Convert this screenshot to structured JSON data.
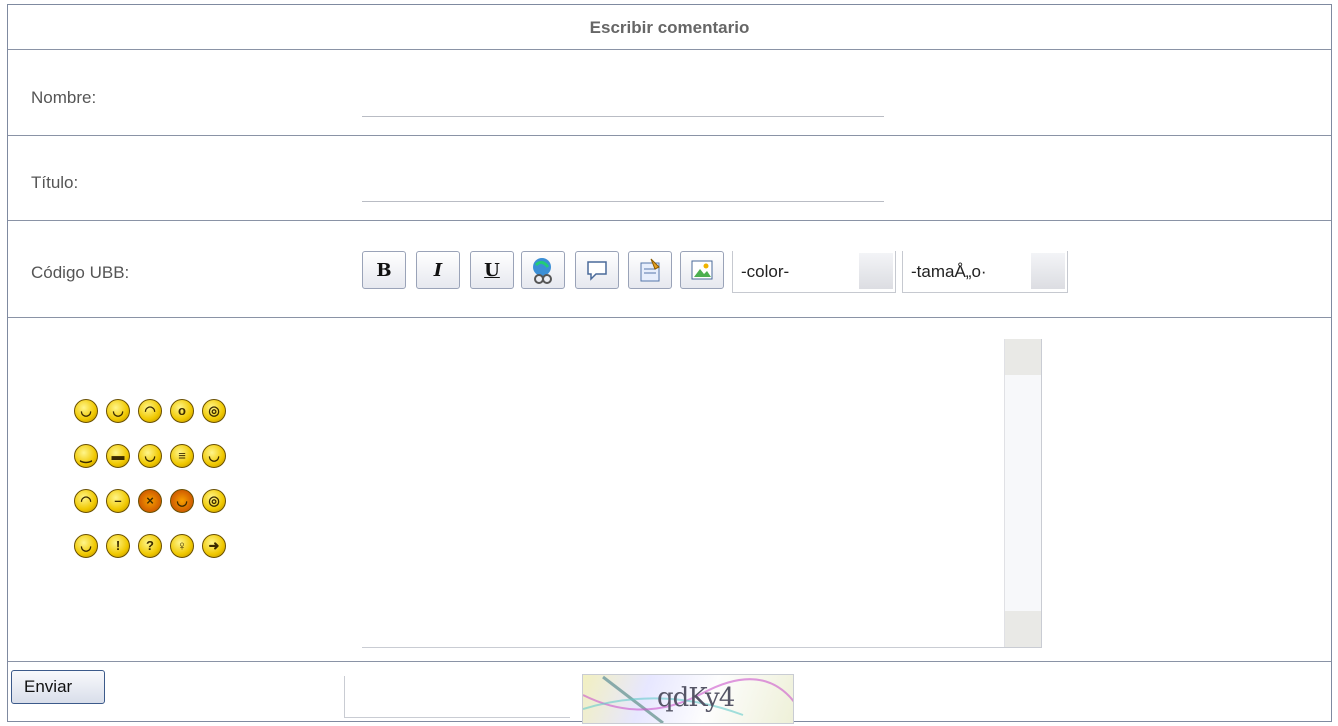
{
  "form": {
    "title": "Escribir comentario",
    "name_label": "Nombre:",
    "title_label": "Título:",
    "ubb_label": "Código UBB:",
    "submit_label": "Enviar",
    "color_select": "-color-",
    "size_select": "-tamaÅ„o·",
    "captcha_text": "qdKy4"
  },
  "toolbar": {
    "bold": "B",
    "italic": "I",
    "underline": "U"
  },
  "smilies": [
    [
      "😀",
      "😀",
      "😟",
      "😲",
      "😵"
    ],
    [
      "🙂",
      "😎",
      "😃",
      "😣",
      "😛"
    ],
    [
      "😢",
      "😐",
      "😡",
      "😈",
      "😳"
    ],
    [
      "😉",
      "!",
      "?",
      "💡",
      "➜"
    ]
  ]
}
